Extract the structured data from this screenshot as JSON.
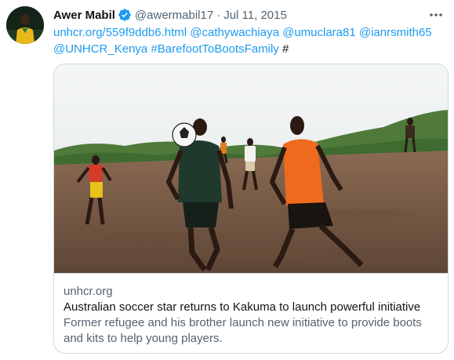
{
  "tweet": {
    "author": {
      "name": "Awer Mabil",
      "handle": "@awermabil17",
      "verified": true,
      "avatar_icon": "avatar-photo"
    },
    "separator": "·",
    "date": "Jul 11, 2015",
    "more_icon": "more-options-icon",
    "text_parts": [
      {
        "text": "unhcr.org/559f9ddb6.html",
        "type": "link"
      },
      {
        "text": " ",
        "type": "text"
      },
      {
        "text": "@cathywachiaya",
        "type": "mention"
      },
      {
        "text": " ",
        "type": "text"
      },
      {
        "text": "@umuclara81",
        "type": "mention"
      },
      {
        "text": " ",
        "type": "text"
      },
      {
        "text": "@ianrsmith65",
        "type": "mention"
      },
      {
        "text": " ",
        "type": "text"
      },
      {
        "text": "@UNHCR_Kenya",
        "type": "mention"
      },
      {
        "text": " ",
        "type": "text"
      },
      {
        "text": "#BarefootToBootsFamily",
        "type": "hashtag"
      },
      {
        "text": " #",
        "type": "text"
      }
    ],
    "card": {
      "domain": "unhcr.org",
      "title": "Australian soccer star returns to Kakuma to launch powerful initiative",
      "description": "Former refugee and his brother launch new initiative to provide boots and kits to help young players.",
      "image_icon": "soccer-players-photo"
    }
  },
  "colors": {
    "link": "#1d9bf0",
    "text": "#0f1419",
    "secondary": "#536471",
    "border": "#cfd9de",
    "verified": "#1d9bf0"
  }
}
